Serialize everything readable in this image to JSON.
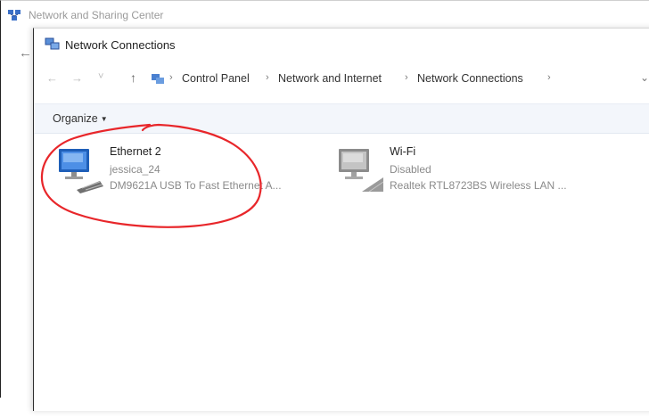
{
  "background_window": {
    "title": "Network and Sharing Center",
    "back_glyph": "←"
  },
  "window": {
    "title": "Network Connections"
  },
  "address_bar": {
    "back_glyph": "←",
    "forward_glyph": "→",
    "recent_glyph": "˅",
    "up_glyph": "↑",
    "breadcrumb": [
      "Control Panel",
      "Network and Internet",
      "Network Connections"
    ],
    "dropdown_glyph": "⌄"
  },
  "toolbar": {
    "organize_label": "Organize",
    "organize_caret": "▼"
  },
  "connections": [
    {
      "name": "Ethernet 2",
      "status": "jessica_24",
      "device": "DM9621A USB To Fast Ethernet A...",
      "icon": "ethernet-adapter-icon",
      "enabled": true
    },
    {
      "name": "Wi-Fi",
      "status": "Disabled",
      "device": "Realtek RTL8723BS Wireless LAN ...",
      "icon": "wifi-adapter-icon",
      "enabled": false
    }
  ],
  "annotation": {
    "shape": "hand-drawn-circle",
    "color": "#e8262a",
    "target": "Ethernet 2"
  }
}
